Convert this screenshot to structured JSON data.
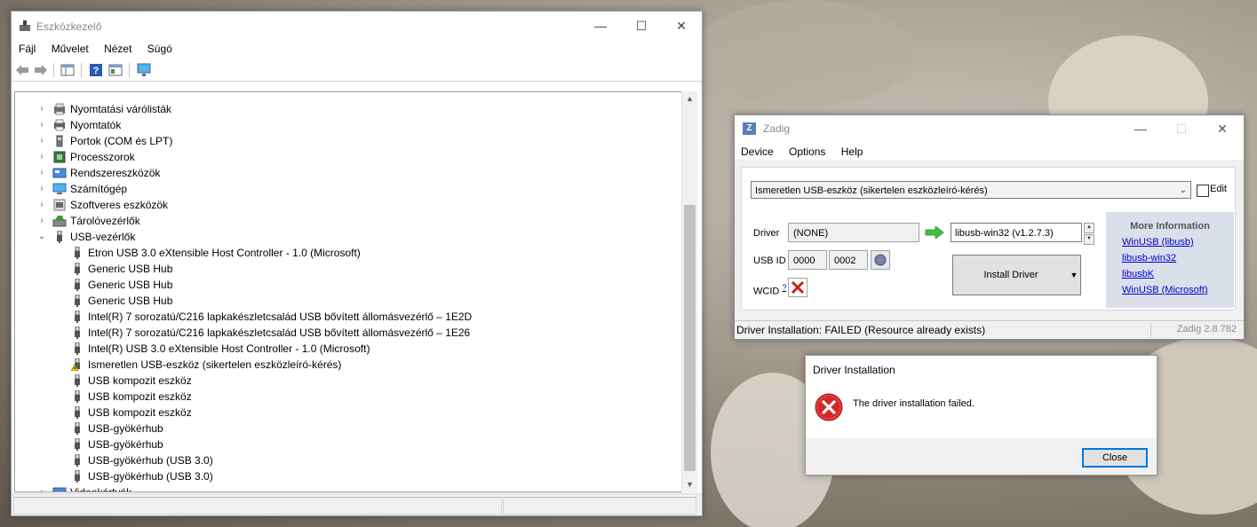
{
  "device_manager": {
    "title": "Eszközkezelő",
    "menu": [
      "Fájl",
      "Művelet",
      "Nézet",
      "Súgó"
    ],
    "tree": [
      {
        "label": "Nyomtatási várólisták",
        "level": 1,
        "expander": "›",
        "icon": "print-queue-icon"
      },
      {
        "label": "Nyomtatók",
        "level": 1,
        "expander": "›",
        "icon": "printer-icon"
      },
      {
        "label": "Portok (COM és LPT)",
        "level": 1,
        "expander": "›",
        "icon": "port-icon"
      },
      {
        "label": "Processzorok",
        "level": 1,
        "expander": "›",
        "icon": "processor-icon"
      },
      {
        "label": "Rendszereszközök",
        "level": 1,
        "expander": "›",
        "icon": "system-device-icon"
      },
      {
        "label": "Számítógép",
        "level": 1,
        "expander": "›",
        "icon": "computer-icon"
      },
      {
        "label": "Szoftveres eszközök",
        "level": 1,
        "expander": "›",
        "icon": "software-device-icon"
      },
      {
        "label": "Tárolóvezérlők",
        "level": 1,
        "expander": "›",
        "icon": "storage-controller-icon"
      },
      {
        "label": "USB-vezérlők",
        "level": 1,
        "expander": "⌄",
        "icon": "usb-icon"
      },
      {
        "label": "Etron USB 3.0 eXtensible Host Controller - 1.0 (Microsoft)",
        "level": 2,
        "icon": "usb-icon"
      },
      {
        "label": "Generic USB Hub",
        "level": 2,
        "icon": "usb-icon"
      },
      {
        "label": "Generic USB Hub",
        "level": 2,
        "icon": "usb-icon"
      },
      {
        "label": "Generic USB Hub",
        "level": 2,
        "icon": "usb-icon"
      },
      {
        "label": "Intel(R) 7 sorozatú/C216 lapkakészletcsalád USB bővített állomásvezérlő – 1E2D",
        "level": 2,
        "icon": "usb-icon"
      },
      {
        "label": "Intel(R) 7 sorozatú/C216 lapkakészletcsalád USB bővített állomásvezérlő – 1E26",
        "level": 2,
        "icon": "usb-icon"
      },
      {
        "label": "Intel(R) USB 3.0 eXtensible Host Controller - 1.0 (Microsoft)",
        "level": 2,
        "icon": "usb-icon"
      },
      {
        "label": "Ismeretlen USB-eszköz (sikertelen eszközleíró-kérés)",
        "level": 2,
        "icon": "usb-warning-icon"
      },
      {
        "label": "USB kompozit eszköz",
        "level": 2,
        "icon": "usb-icon"
      },
      {
        "label": "USB kompozit eszköz",
        "level": 2,
        "icon": "usb-icon"
      },
      {
        "label": "USB kompozit eszköz",
        "level": 2,
        "icon": "usb-icon"
      },
      {
        "label": "USB-gyökérhub",
        "level": 2,
        "icon": "usb-icon"
      },
      {
        "label": "USB-gyökérhub",
        "level": 2,
        "icon": "usb-icon"
      },
      {
        "label": "USB-gyökérhub (USB 3.0)",
        "level": 2,
        "icon": "usb-icon"
      },
      {
        "label": "USB-gyökérhub (USB 3.0)",
        "level": 2,
        "icon": "usb-icon"
      },
      {
        "label": "Videokártyák",
        "level": 1,
        "expander": "›",
        "icon": "display-adapter-icon"
      }
    ]
  },
  "zadig": {
    "title": "Zadig",
    "menu": [
      "Device",
      "Options",
      "Help"
    ],
    "device_selected": "Ismeretlen USB-eszköz (sikertelen eszközleíró-kérés)",
    "edit_label": "Edit",
    "driver_label": "Driver",
    "driver_current": "(NONE)",
    "driver_target": "libusb-win32 (v1.2.7.3)",
    "usbid_label": "USB ID",
    "usbid_vid": "0000",
    "usbid_pid": "0002",
    "wcid_label": "WCID",
    "wcid_sup": "?",
    "install_button": "Install Driver",
    "more_info_title": "More Information",
    "links": [
      "WinUSB (libusb)",
      "libusb-win32",
      "libusbK",
      "WinUSB (Microsoft)"
    ],
    "status": "Driver Installation: FAILED (Resource already exists)",
    "version": "Zadig 2.8.782"
  },
  "dialog": {
    "title": "Driver Installation",
    "message": "The driver installation failed.",
    "close_button": "Close"
  },
  "colors": {
    "accent": "#0078d7",
    "link": "#0000cc",
    "error": "#cc1f1f",
    "arrow_green": "#3cc13c"
  }
}
